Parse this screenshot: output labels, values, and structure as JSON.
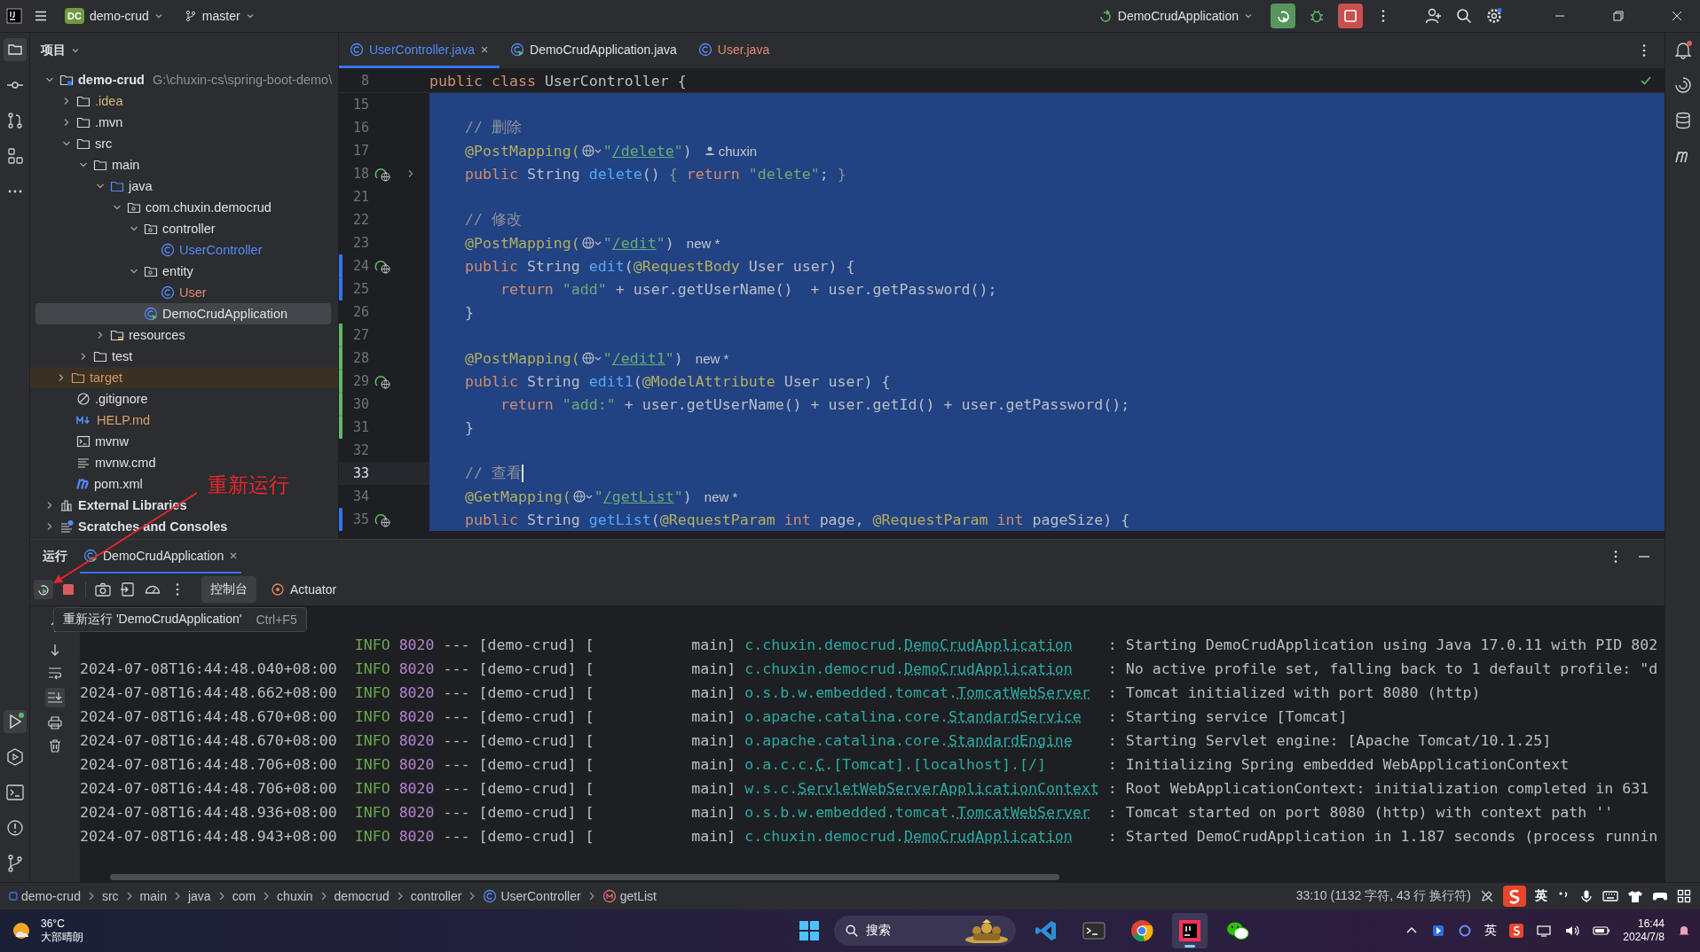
{
  "title_bar": {
    "project_badge": "DC",
    "project": "demo-crud",
    "branch": "master",
    "run_config": "DemoCrudApplication"
  },
  "project_panel": {
    "title": "项目",
    "tree": [
      {
        "label": "demo-crud",
        "path": "G:\\chuxin-cs\\spring-boot-demo\\",
        "kind": "module",
        "color": "#dfe1e5",
        "expanded": true,
        "selected": false,
        "excluded": false,
        "children": [
          {
            "label": ".idea",
            "kind": "folder",
            "color": "#d5b778",
            "expanded": false,
            "selected": false,
            "excluded": false
          },
          {
            "label": ".mvn",
            "kind": "folder",
            "color": "#dfe1e5",
            "expanded": false,
            "selected": false,
            "excluded": false
          },
          {
            "label": "src",
            "kind": "folder",
            "color": "#dfe1e5",
            "expanded": true,
            "selected": false,
            "excluded": false,
            "children": [
              {
                "label": "main",
                "kind": "folder",
                "color": "#dfe1e5",
                "expanded": true,
                "selected": false,
                "excluded": false,
                "children": [
                  {
                    "label": "java",
                    "kind": "source-folder",
                    "color": "#dfe1e5",
                    "expanded": true,
                    "selected": false,
                    "excluded": false,
                    "children": [
                      {
                        "label": "com.chuxin.democrud",
                        "kind": "package",
                        "color": "#dfe1e5",
                        "expanded": true,
                        "selected": false,
                        "excluded": false,
                        "children": [
                          {
                            "label": "controller",
                            "kind": "package",
                            "color": "#dfe1e5",
                            "expanded": true,
                            "selected": false,
                            "excluded": false,
                            "children": [
                              {
                                "label": "UserController",
                                "kind": "class",
                                "color": "#548af7",
                                "selected": false,
                                "excluded": false
                              }
                            ]
                          },
                          {
                            "label": "entity",
                            "kind": "package",
                            "color": "#dfe1e5",
                            "expanded": true,
                            "selected": false,
                            "excluded": false,
                            "children": [
                              {
                                "label": "User",
                                "kind": "class",
                                "color": "#e08a74",
                                "selected": false,
                                "excluded": false
                              }
                            ]
                          },
                          {
                            "label": "DemoCrudApplication",
                            "kind": "app-class",
                            "color": "#dfe1e5",
                            "selected": true,
                            "excluded": false
                          }
                        ]
                      }
                    ]
                  },
                  {
                    "label": "resources",
                    "kind": "resources",
                    "color": "#dfe1e5",
                    "expanded": false,
                    "selected": false,
                    "excluded": false
                  }
                ]
              },
              {
                "label": "test",
                "kind": "folder",
                "color": "#dfe1e5",
                "expanded": false,
                "selected": false,
                "excluded": false
              }
            ]
          },
          {
            "label": "target",
            "kind": "excluded-folder",
            "color": "#d19a66",
            "expanded": false,
            "selected": false,
            "excluded": true
          },
          {
            "label": ".gitignore",
            "kind": "ignore",
            "color": "#dfe1e5",
            "selected": false,
            "excluded": false
          },
          {
            "label": "HELP.md",
            "kind": "markdown",
            "color": "#d5a06a",
            "selected": false,
            "excluded": false
          },
          {
            "label": "mvnw",
            "kind": "terminal",
            "color": "#dfe1e5",
            "selected": false,
            "excluded": false
          },
          {
            "label": "mvnw.cmd",
            "kind": "text",
            "color": "#dfe1e5",
            "selected": false,
            "excluded": false
          },
          {
            "label": "pom.xml",
            "kind": "maven",
            "color": "#dfe1e5",
            "selected": false,
            "excluded": false
          }
        ]
      },
      {
        "label": "External Libraries",
        "kind": "libraries",
        "color": "#dfe1e5",
        "expanded": false,
        "selected": false,
        "excluded": false
      },
      {
        "label": "Scratches and Consoles",
        "kind": "scratches",
        "color": "#dfe1e5",
        "expanded": false,
        "selected": false,
        "excluded": false
      }
    ]
  },
  "annotation": {
    "text": "重新运行"
  },
  "editor": {
    "tabs": [
      {
        "label": "UserController.java",
        "kind": "class",
        "color": "#548af7",
        "selected": true,
        "closable": true
      },
      {
        "label": "DemoCrudApplication.java",
        "kind": "app-class",
        "color": "#dfe1e5",
        "selected": false,
        "closable": false
      },
      {
        "label": "User.java",
        "kind": "class",
        "color": "#e08a74",
        "selected": false,
        "closable": false
      }
    ],
    "sticky": {
      "number": "8",
      "segments": [
        {
          "kind": "code",
          "tokens": [
            {
              "kind": "kw",
              "text": "public class "
            },
            {
              "kind": "plain",
              "text": "UserController {"
            }
          ]
        }
      ]
    },
    "lines": [
      {
        "number": "15",
        "current": false,
        "gutter_icon": false,
        "folded": false
      },
      {
        "number": "16",
        "current": false,
        "gutter_icon": false,
        "folded": false,
        "segments": [
          {
            "kind": "code",
            "tokens": [
              {
                "kind": "comment",
                "text": "    // 删除"
              }
            ]
          }
        ]
      },
      {
        "number": "17",
        "current": false,
        "gutter_icon": false,
        "folded": false,
        "segments": [
          {
            "kind": "code",
            "tokens": [
              {
                "kind": "ann",
                "text": "    @PostMapping("
              }
            ]
          },
          {
            "kind": "web"
          },
          {
            "kind": "code",
            "tokens": [
              {
                "kind": "str",
                "text": "\""
              },
              {
                "kind": "link",
                "text": "/delete"
              },
              {
                "kind": "str",
                "text": "\""
              },
              {
                "kind": "plain",
                "text": ")"
              }
            ]
          },
          {
            "kind": "author",
            "text": "chuxin"
          }
        ]
      },
      {
        "number": "18",
        "current": false,
        "gutter_icon": true,
        "folded": true,
        "segments": [
          {
            "kind": "code",
            "tokens": [
              {
                "kind": "kw",
                "text": "    public "
              },
              {
                "kind": "plain",
                "text": "String "
              },
              {
                "kind": "fn",
                "text": "delete"
              },
              {
                "kind": "plain",
                "text": "() "
              },
              {
                "kind": "fold",
                "text": "{ "
              },
              {
                "kind": "kw",
                "text": "return "
              },
              {
                "kind": "str",
                "text": "\"delete\""
              },
              {
                "kind": "plain",
                "text": "; "
              },
              {
                "kind": "fold",
                "text": "}"
              }
            ]
          }
        ]
      },
      {
        "number": "21",
        "current": false,
        "gutter_icon": false,
        "folded": false
      },
      {
        "number": "22",
        "current": false,
        "gutter_icon": false,
        "folded": false,
        "segments": [
          {
            "kind": "code",
            "tokens": [
              {
                "kind": "comment",
                "text": "    // 修改"
              }
            ]
          }
        ]
      },
      {
        "number": "23",
        "current": false,
        "gutter_icon": false,
        "folded": false,
        "segments": [
          {
            "kind": "code",
            "tokens": [
              {
                "kind": "ann",
                "text": "    @PostMapping("
              }
            ]
          },
          {
            "kind": "web"
          },
          {
            "kind": "code",
            "tokens": [
              {
                "kind": "str",
                "text": "\""
              },
              {
                "kind": "link",
                "text": "/edit"
              },
              {
                "kind": "str",
                "text": "\""
              },
              {
                "kind": "plain",
                "text": ")"
              }
            ]
          },
          {
            "kind": "hint",
            "text": "new *"
          }
        ]
      },
      {
        "number": "24",
        "color": "#3574f0",
        "current": false,
        "gutter_icon": true,
        "folded": false,
        "segments": [
          {
            "kind": "code",
            "tokens": [
              {
                "kind": "kw",
                "text": "    public "
              },
              {
                "kind": "plain",
                "text": "String "
              },
              {
                "kind": "fn",
                "text": "edit"
              },
              {
                "kind": "plain",
                "text": "("
              },
              {
                "kind": "ann",
                "text": "@RequestBody"
              },
              {
                "kind": "plain",
                "text": " User user) {"
              }
            ]
          }
        ]
      },
      {
        "number": "25",
        "color": "#3574f0",
        "current": false,
        "gutter_icon": false,
        "folded": false,
        "segments": [
          {
            "kind": "code",
            "tokens": [
              {
                "kind": "kw",
                "text": "        return "
              },
              {
                "kind": "str",
                "text": "\"add\""
              },
              {
                "kind": "plain",
                "text": " + user.getUserName()  + user.getPassword();"
              }
            ]
          }
        ]
      },
      {
        "number": "26",
        "current": false,
        "gutter_icon": false,
        "folded": false,
        "segments": [
          {
            "kind": "code",
            "tokens": [
              {
                "kind": "plain",
                "text": "    }"
              }
            ]
          }
        ]
      },
      {
        "number": "27",
        "color": "#5fb865",
        "current": false,
        "gutter_icon": false,
        "folded": false
      },
      {
        "number": "28",
        "color": "#5fb865",
        "current": false,
        "gutter_icon": false,
        "folded": false,
        "segments": [
          {
            "kind": "code",
            "tokens": [
              {
                "kind": "ann",
                "text": "    @PostMapping("
              }
            ]
          },
          {
            "kind": "web"
          },
          {
            "kind": "code",
            "tokens": [
              {
                "kind": "str",
                "text": "\""
              },
              {
                "kind": "link",
                "text": "/edit1"
              },
              {
                "kind": "str",
                "text": "\""
              },
              {
                "kind": "plain",
                "text": ")"
              }
            ]
          },
          {
            "kind": "hint",
            "text": "new *"
          }
        ]
      },
      {
        "number": "29",
        "color": "#5fb865",
        "current": false,
        "gutter_icon": true,
        "folded": false,
        "segments": [
          {
            "kind": "code",
            "tokens": [
              {
                "kind": "kw",
                "text": "    public "
              },
              {
                "kind": "plain",
                "text": "String "
              },
              {
                "kind": "fn",
                "text": "edit1"
              },
              {
                "kind": "plain",
                "text": "("
              },
              {
                "kind": "ann",
                "text": "@ModelAttribute"
              },
              {
                "kind": "plain",
                "text": " User user) {"
              }
            ]
          }
        ]
      },
      {
        "number": "30",
        "color": "#5fb865",
        "current": false,
        "gutter_icon": false,
        "folded": false,
        "segments": [
          {
            "kind": "code",
            "tokens": [
              {
                "kind": "kw",
                "text": "        return "
              },
              {
                "kind": "str",
                "text": "\"add:\""
              },
              {
                "kind": "plain",
                "text": " + user.getUserName() + user.getId() + user.getPassword();"
              }
            ]
          }
        ]
      },
      {
        "number": "31",
        "color": "#5fb865",
        "current": false,
        "gutter_icon": false,
        "folded": false,
        "segments": [
          {
            "kind": "code",
            "tokens": [
              {
                "kind": "plain",
                "text": "    }"
              }
            ]
          }
        ]
      },
      {
        "number": "32",
        "current": false,
        "gutter_icon": false,
        "folded": false
      },
      {
        "number": "33",
        "current": true,
        "gutter_icon": false,
        "folded": false,
        "segments": [
          {
            "kind": "code",
            "tokens": [
              {
                "kind": "comment",
                "text": "    // 查看"
              }
            ]
          }
        ]
      },
      {
        "number": "34",
        "current": false,
        "gutter_icon": false,
        "folded": false,
        "segments": [
          {
            "kind": "code",
            "tokens": [
              {
                "kind": "ann",
                "text": "    @GetMapping("
              }
            ]
          },
          {
            "kind": "web"
          },
          {
            "kind": "code",
            "tokens": [
              {
                "kind": "str",
                "text": "\""
              },
              {
                "kind": "link",
                "text": "/getList"
              },
              {
                "kind": "str",
                "text": "\""
              },
              {
                "kind": "plain",
                "text": ")"
              }
            ]
          },
          {
            "kind": "hint",
            "text": "new *"
          }
        ]
      },
      {
        "number": "35",
        "color": "#3574f0",
        "current": false,
        "gutter_icon": true,
        "folded": false,
        "segments": [
          {
            "kind": "code",
            "tokens": [
              {
                "kind": "kw",
                "text": "    public "
              },
              {
                "kind": "plain",
                "text": "String "
              },
              {
                "kind": "fn",
                "text": "getList"
              },
              {
                "kind": "plain",
                "text": "("
              },
              {
                "kind": "ann",
                "text": "@RequestParam "
              },
              {
                "kind": "kw",
                "text": "int"
              },
              {
                "kind": "plain",
                "text": " page, "
              },
              {
                "kind": "ann",
                "text": "@RequestParam "
              },
              {
                "kind": "kw",
                "text": "int"
              },
              {
                "kind": "plain",
                "text": " pageSize) {"
              }
            ]
          }
        ]
      }
    ]
  },
  "run_panel": {
    "title": "运行",
    "tab": {
      "label": "DemoCrudApplication"
    },
    "tool_tabs": [
      {
        "label": "控制台",
        "selected": true
      },
      {
        "label": "Actuator",
        "selected": false,
        "kind": "actuator"
      }
    ],
    "tooltip": {
      "text": "重新运行 'DemoCrudApplication'",
      "shortcut": "Ctrl+F5"
    },
    "log": [
      {
        "level": "INFO",
        "pid": "8020",
        "separator": "---",
        "app": "[demo-crud]",
        "thread": "[           main]",
        "logger": "c.chuxin.democrud.",
        "logger_class": "DemoCrudApplication",
        "message": ": Starting DemoCrudApplication using Java 17.0.11 with PID 802"
      },
      {
        "timestamp": "2024-07-08T16:44:48.040+08:00",
        "level": "INFO",
        "pid": "8020",
        "separator": "---",
        "app": "[demo-crud]",
        "thread": "[           main]",
        "logger": "c.chuxin.democrud.",
        "logger_class": "DemoCrudApplication",
        "message": ": No active profile set, falling back to 1 default profile: \"d"
      },
      {
        "timestamp": "2024-07-08T16:44:48.662+08:00",
        "level": "INFO",
        "pid": "8020",
        "separator": "---",
        "app": "[demo-crud]",
        "thread": "[           main]",
        "logger": "o.s.b.w.embedded.tomcat.",
        "logger_class": "TomcatWebServer",
        "message": ": Tomcat initialized with port 8080 (http)"
      },
      {
        "timestamp": "2024-07-08T16:44:48.670+08:00",
        "level": "INFO",
        "pid": "8020",
        "separator": "---",
        "app": "[demo-crud]",
        "thread": "[           main]",
        "logger": "o.apache.catalina.core.",
        "logger_class": "StandardService",
        "message": ": Starting service [Tomcat]"
      },
      {
        "timestamp": "2024-07-08T16:44:48.670+08:00",
        "level": "INFO",
        "pid": "8020",
        "separator": "---",
        "app": "[demo-crud]",
        "thread": "[           main]",
        "logger": "o.apache.catalina.core.",
        "logger_class": "StandardEngine",
        "message": ": Starting Servlet engine: [Apache Tomcat/10.1.25]"
      },
      {
        "timestamp": "2024-07-08T16:44:48.706+08:00",
        "level": "INFO",
        "pid": "8020",
        "separator": "---",
        "app": "[demo-crud]",
        "thread": "[           main]",
        "logger": "o.a.c.c.",
        "logger_class": "C",
        "logger_suffix": ".[Tomcat].[localhost].[/]",
        "message": ": Initializing Spring embedded WebApplicationContext"
      },
      {
        "timestamp": "2024-07-08T16:44:48.706+08:00",
        "level": "INFO",
        "pid": "8020",
        "separator": "---",
        "app": "[demo-crud]",
        "thread": "[           main]",
        "logger": "w.s.c.",
        "logger_class": "ServletWebServerApplicationContext",
        "message": ": Root WebApplicationContext: initialization completed in 631"
      },
      {
        "timestamp": "2024-07-08T16:44:48.936+08:00",
        "level": "INFO",
        "pid": "8020",
        "separator": "---",
        "app": "[demo-crud]",
        "thread": "[           main]",
        "logger": "o.s.b.w.embedded.tomcat.",
        "logger_class": "TomcatWebServer",
        "message": ": Tomcat started on port 8080 (http) with context path ''"
      },
      {
        "timestamp": "2024-07-08T16:44:48.943+08:00",
        "level": "INFO",
        "pid": "8020",
        "separator": "---",
        "app": "[demo-crud]",
        "thread": "[           main]",
        "logger": "c.chuxin.democrud.",
        "logger_class": "DemoCrudApplication",
        "message": ": Started DemoCrudApplication in 1.187 seconds (process runnin"
      }
    ]
  },
  "status_bar": {
    "breadcrumbs": [
      {
        "label": "demo-crud",
        "kind": "module"
      },
      {
        "label": "src"
      },
      {
        "label": "main"
      },
      {
        "label": "java"
      },
      {
        "label": "com"
      },
      {
        "label": "chuxin"
      },
      {
        "label": "democrud"
      },
      {
        "label": "controller"
      },
      {
        "label": "UserController",
        "kind": "class"
      },
      {
        "label": "getList",
        "kind": "method"
      }
    ],
    "position": "33:10 (1132 字符, 43 行 换行符)",
    "ime": "英"
  },
  "taskbar": {
    "temperature": "36°C",
    "weather": "大部晴朗",
    "search": "搜索",
    "apps": [
      {
        "kind": "vscode",
        "selected": false
      },
      {
        "kind": "terminal",
        "selected": false
      },
      {
        "kind": "chrome",
        "selected": false
      },
      {
        "kind": "intellij",
        "selected": true
      },
      {
        "kind": "wechat",
        "selected": false
      }
    ],
    "ime": "英",
    "time": "16:44",
    "date": "2024/7/8"
  }
}
